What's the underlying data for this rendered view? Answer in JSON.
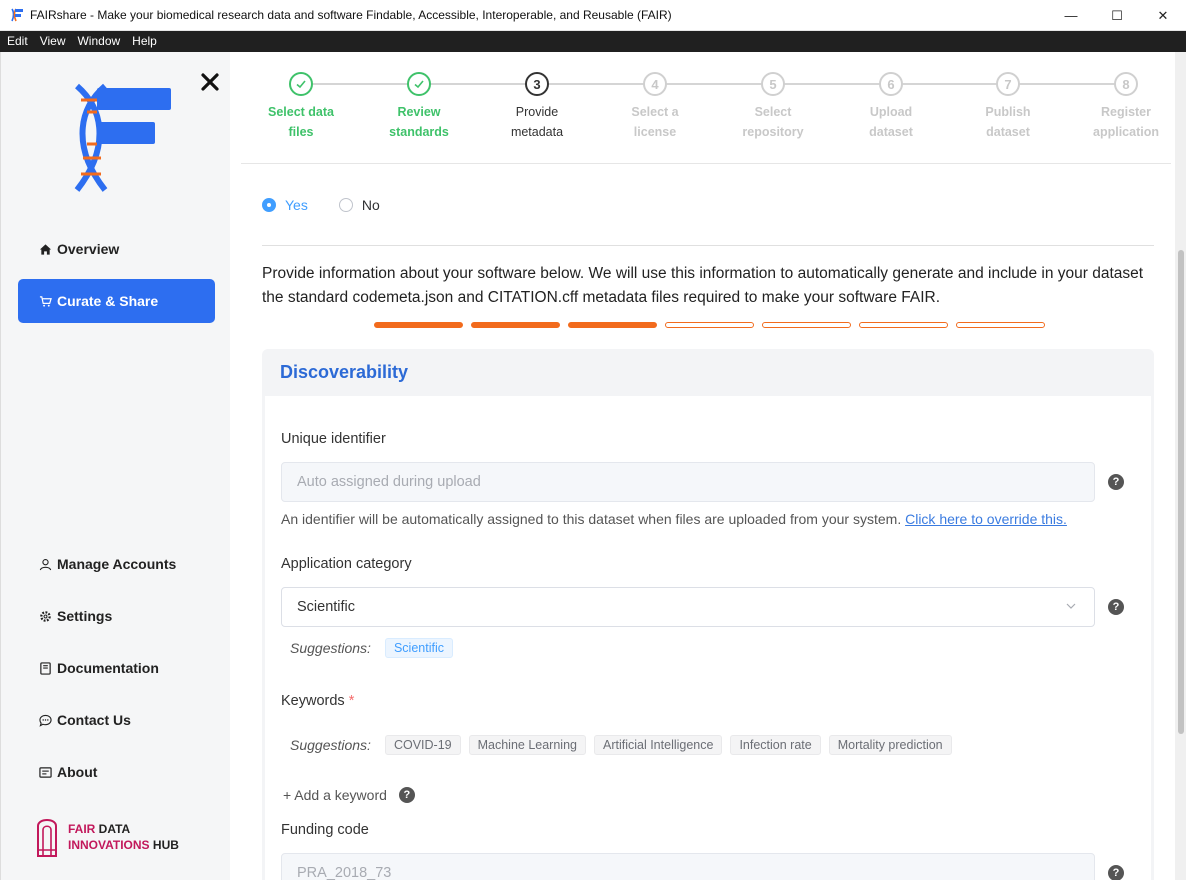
{
  "window": {
    "title": "FAIRshare - Make your biomedical research data and software Findable, Accessible, Interoperable, and Reusable (FAIR)",
    "minimize": "—",
    "maximize": "☐",
    "close": "✕"
  },
  "menu": [
    "Edit",
    "View",
    "Window",
    "Help"
  ],
  "sidebar": {
    "nav_top": [
      {
        "label": "Overview",
        "icon": "home-icon"
      },
      {
        "label": "Curate & Share",
        "icon": "cart-icon"
      }
    ],
    "nav_bottom": [
      {
        "label": "Manage Accounts",
        "icon": "user-icon"
      },
      {
        "label": "Settings",
        "icon": "gear-icon"
      },
      {
        "label": "Documentation",
        "icon": "book-icon"
      },
      {
        "label": "Contact Us",
        "icon": "chat-icon"
      },
      {
        "label": "About",
        "icon": "info-card-icon"
      }
    ],
    "hub_logo": {
      "line1_a": "FAIR",
      "line1_b": " DATA",
      "line2_a": "INNOVATIONS",
      "line2_b": " HUB"
    },
    "colors": {
      "active": "#2d6ef0",
      "logo_blue": "#2d6ef0",
      "logo_orange": "#f26b1d"
    }
  },
  "stepper": [
    {
      "num": "1",
      "line1": "Select data",
      "line2": "files",
      "state": "done"
    },
    {
      "num": "2",
      "line1": "Review",
      "line2": "standards",
      "state": "done"
    },
    {
      "num": "3",
      "line1": "Provide",
      "line2": "metadata",
      "state": "current"
    },
    {
      "num": "4",
      "line1": "Select a",
      "line2": "license",
      "state": "todo"
    },
    {
      "num": "5",
      "line1": "Select",
      "line2": "repository",
      "state": "todo"
    },
    {
      "num": "6",
      "line1": "Upload",
      "line2": "dataset",
      "state": "todo"
    },
    {
      "num": "7",
      "line1": "Publish",
      "line2": "dataset",
      "state": "todo"
    },
    {
      "num": "8",
      "line1": "Register",
      "line2": "application",
      "state": "todo"
    }
  ],
  "radio": {
    "yes": "Yes",
    "no": "No",
    "selected": "yes"
  },
  "intro": "Provide information about your software below. We will use this information to automatically generate and include in your dataset the standard codemeta.json and CITATION.cff metadata files required to make your software FAIR.",
  "progress": {
    "total": 7,
    "completed": 3,
    "color": "#f26b1d"
  },
  "form": {
    "section_title": "Discoverability",
    "unique_identifier": {
      "label": "Unique identifier",
      "placeholder": "Auto assigned during upload",
      "hint": "An identifier will be automatically assigned to this dataset when files are uploaded from your system. ",
      "hint_link": "Click here to override this."
    },
    "application_category": {
      "label": "Application category",
      "value": "Scientific",
      "suggestions_label": "Suggestions:",
      "suggestions": [
        "Scientific"
      ]
    },
    "keywords": {
      "label": "Keywords",
      "required": "*",
      "suggestions_label": "Suggestions:",
      "suggestions": [
        "COVID-19",
        "Machine Learning",
        "Artificial Intelligence",
        "Infection rate",
        "Mortality prediction"
      ],
      "add_label": "+ Add a keyword"
    },
    "funding_code": {
      "label": "Funding code",
      "placeholder": "PRA_2018_73"
    },
    "help_glyph": "?"
  }
}
